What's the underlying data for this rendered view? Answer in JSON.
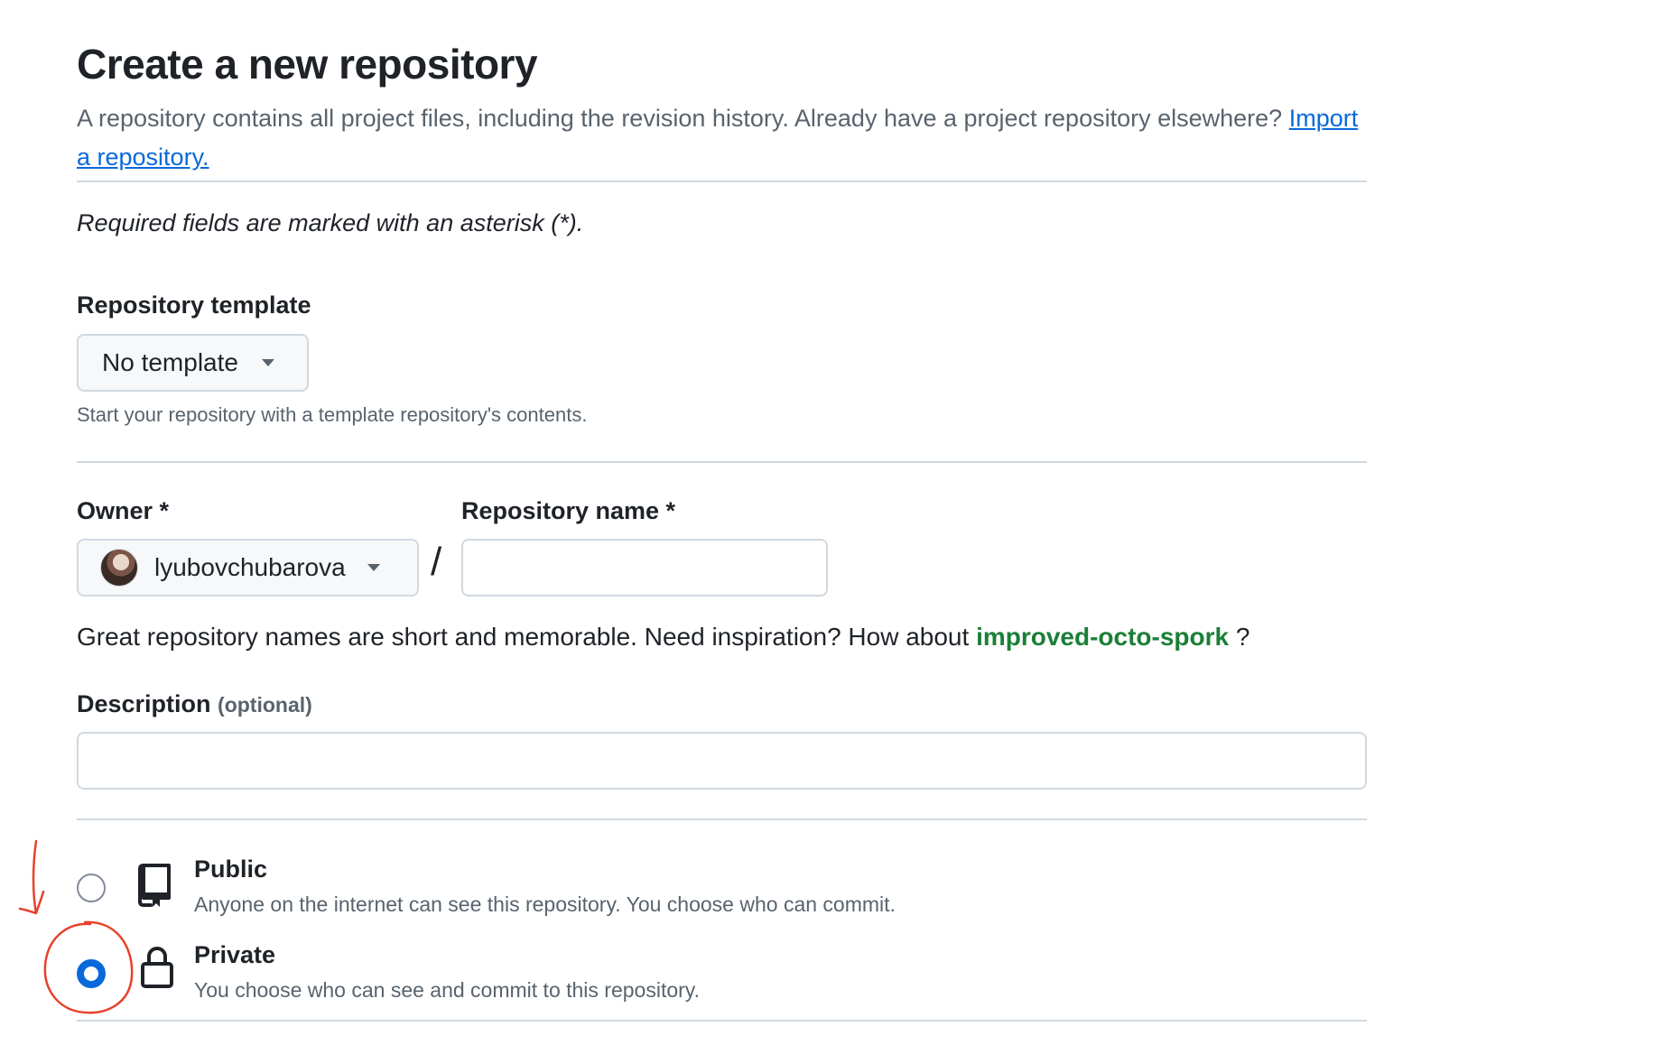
{
  "header": {
    "title": "Create a new repository",
    "description": "A repository contains all project files, including the revision history. Already have a project repository elsewhere?",
    "import_link": "Import a repository."
  },
  "required_note": "Required fields are marked with an asterisk (*).",
  "template": {
    "label": "Repository template",
    "selected": "No template",
    "hint": "Start your repository with a template repository's contents."
  },
  "owner": {
    "label": "Owner *",
    "selected": "lyubovchubarova"
  },
  "repo_name": {
    "label": "Repository name *",
    "value": "",
    "separator": "/"
  },
  "name_suggestion": {
    "text": "Great repository names are short and memorable. Need inspiration? How about",
    "name": "improved-octo-spork",
    "suffix": "?"
  },
  "description_field": {
    "label": "Description",
    "optional": "(optional)",
    "value": ""
  },
  "visibility": {
    "options": [
      {
        "title": "Public",
        "description": "Anyone on the internet can see this repository. You choose who can commit.",
        "icon": "repo-icon",
        "checked": false
      },
      {
        "title": "Private",
        "description": "You choose who can see and commit to this repository.",
        "icon": "lock-icon",
        "checked": true
      }
    ]
  },
  "colors": {
    "accent": "#0969da",
    "link": "#0969da",
    "suggestion": "#1a7f37",
    "annotation": "#e8412c"
  }
}
